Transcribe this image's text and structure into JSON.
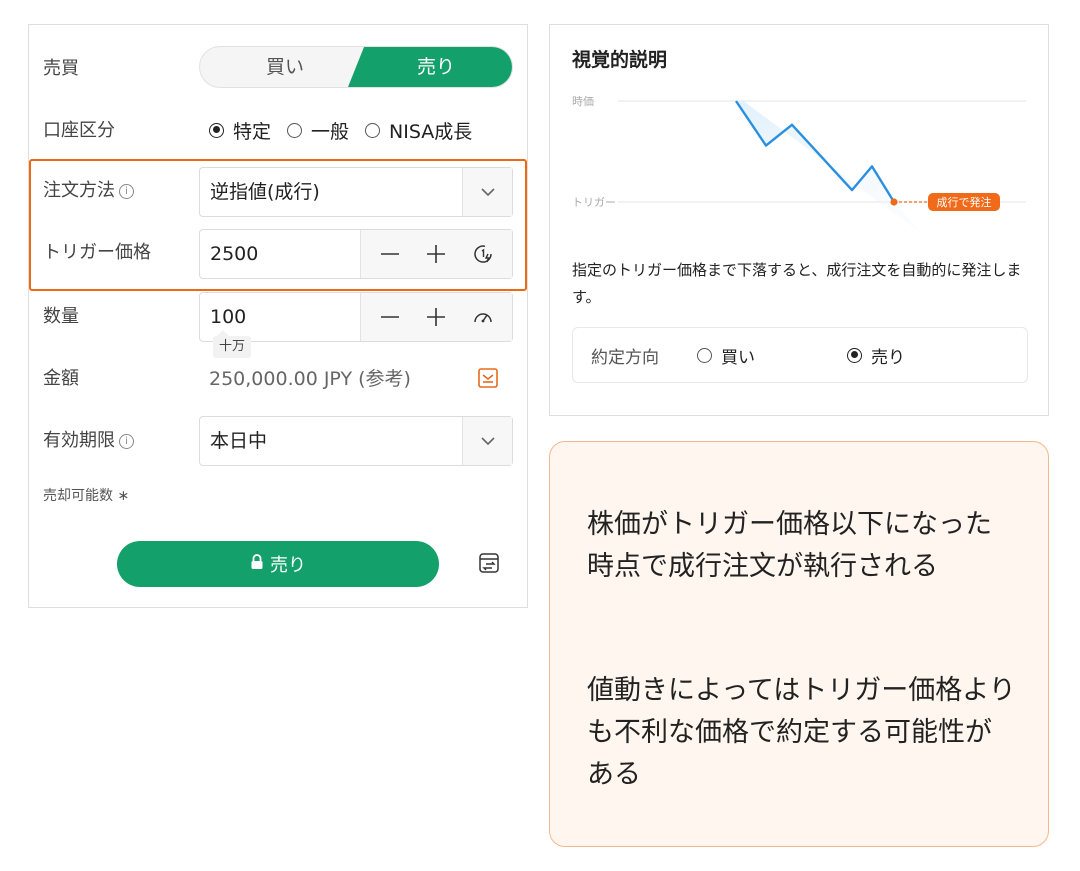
{
  "order_form": {
    "side": {
      "label": "売買",
      "buy": "買い",
      "sell": "売り",
      "selected": "sell"
    },
    "account": {
      "label": "口座区分",
      "options": [
        "特定",
        "一般",
        "NISA成長"
      ],
      "selected": 0
    },
    "order_method": {
      "label": "注文方法",
      "value": "逆指値(成行)"
    },
    "trigger_price": {
      "label": "トリガー価格",
      "value": "2500"
    },
    "quantity": {
      "label": "数量",
      "value": "100",
      "hint": "十万"
    },
    "amount": {
      "label": "金額",
      "value": "250,000.00 JPY (参考)"
    },
    "expiry": {
      "label": "有効期限",
      "value": "本日中"
    },
    "sellable": {
      "label": "売却可能数",
      "value": "∗"
    },
    "submit_label": "売り",
    "info_glyph": "i"
  },
  "explanation": {
    "title": "視覚的説明",
    "chart_data": {
      "type": "line",
      "labels": {
        "price": "時価",
        "trigger": "トリガー"
      },
      "trigger_badge": "成行で発注",
      "series": [
        {
          "values": [
            100,
            85,
            92,
            70,
            78,
            66
          ]
        }
      ],
      "trigger_level": 66,
      "colors": {
        "line": "#2b8fe0",
        "trigger": "#f06a1a"
      }
    },
    "description": "指定のトリガー価格まで下落すると、成行注文を自動的に発注します。",
    "direction": {
      "label": "約定方向",
      "options": [
        "買い",
        "売り"
      ],
      "selected": 1
    }
  },
  "notes": [
    "株価がトリガー価格以下になった時点で成行注文が執行される",
    "値動きによってはトリガー価格よりも不利な価格で約定する可能性がある"
  ],
  "colors": {
    "brand_green": "#14a06a",
    "highlight_orange": "#ec6a14"
  }
}
